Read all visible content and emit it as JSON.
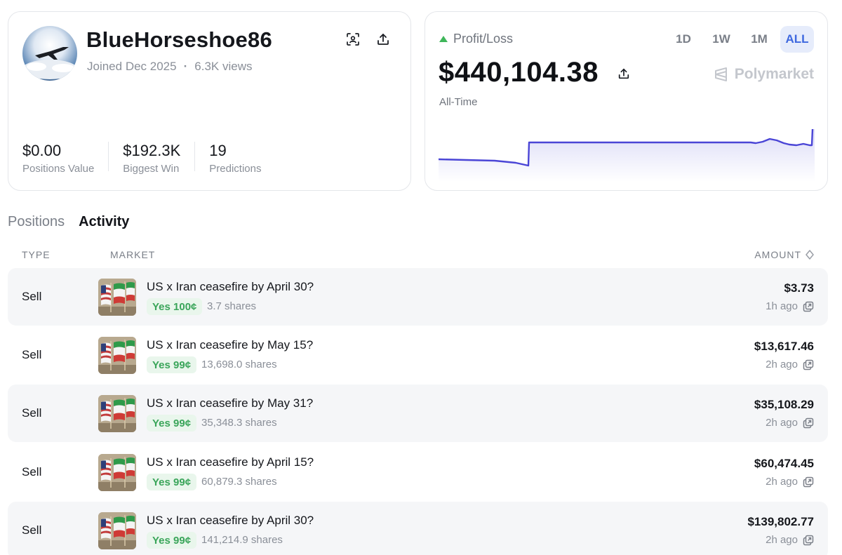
{
  "profile": {
    "username": "BlueHorseshoe86",
    "joined": "Joined Dec 2025",
    "separator": "·",
    "views": "6.3K views",
    "stats": [
      {
        "value": "$0.00",
        "label": "Positions Value"
      },
      {
        "value": "$192.3K",
        "label": "Biggest Win"
      },
      {
        "value": "19",
        "label": "Predictions"
      }
    ]
  },
  "pnl": {
    "label": "Profit/Loss",
    "value": "$440,104.38",
    "period": "All-Time",
    "brand": "Polymarket",
    "ranges": [
      "1D",
      "1W",
      "1M",
      "ALL"
    ],
    "active_range": "ALL",
    "colors": {
      "up": "#3fb65a",
      "line": "#4a45d6",
      "active_bg": "#e6ecfb"
    }
  },
  "tabs": [
    {
      "label": "Positions",
      "active": false
    },
    {
      "label": "Activity",
      "active": true
    }
  ],
  "table": {
    "headers": {
      "type": "TYPE",
      "market": "MARKET",
      "amount": "AMOUNT"
    },
    "rows": [
      {
        "type": "Sell",
        "title": "US x Iran ceasefire by April 30?",
        "badge": "Yes 100¢",
        "shares": "3.7 shares",
        "amount": "$3.73",
        "time": "1h ago"
      },
      {
        "type": "Sell",
        "title": "US x Iran ceasefire by May 15?",
        "badge": "Yes 99¢",
        "shares": "13,698.0 shares",
        "amount": "$13,617.46",
        "time": "2h ago"
      },
      {
        "type": "Sell",
        "title": "US x Iran ceasefire by May 31?",
        "badge": "Yes 99¢",
        "shares": "35,348.3 shares",
        "amount": "$35,108.29",
        "time": "2h ago"
      },
      {
        "type": "Sell",
        "title": "US x Iran ceasefire by April 15?",
        "badge": "Yes 99¢",
        "shares": "60,879.3 shares",
        "amount": "$60,474.45",
        "time": "2h ago"
      },
      {
        "type": "Sell",
        "title": "US x Iran ceasefire by April 30?",
        "badge": "Yes 99¢",
        "shares": "141,214.9 shares",
        "amount": "$139,802.77",
        "time": "2h ago"
      }
    ]
  },
  "icons": {
    "scan": "scan-profile-icon",
    "share": "share-icon",
    "sort": "sort-icon",
    "external": "open-link-icon",
    "brand": "polymarket-logo-icon"
  }
}
